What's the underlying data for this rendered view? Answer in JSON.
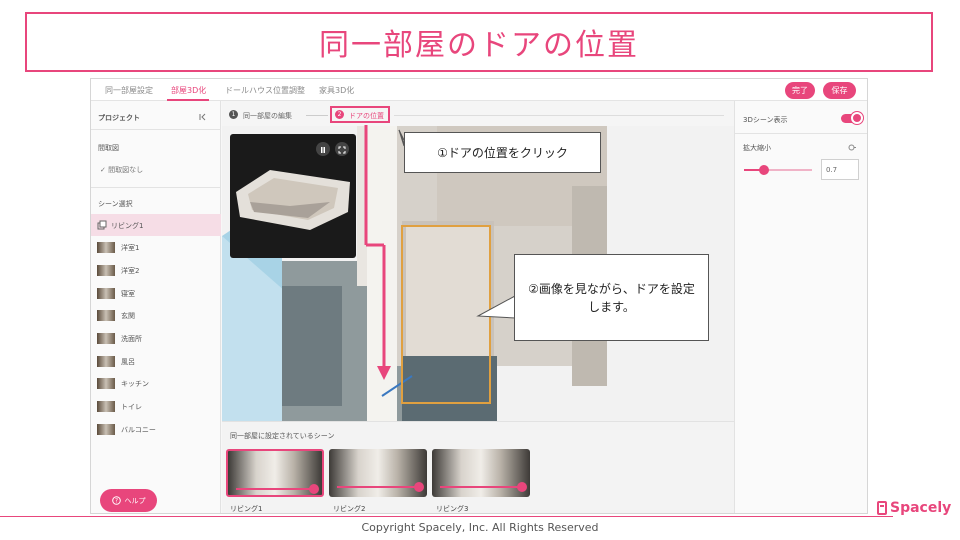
{
  "slide_title": "同一部屋のドアの位置",
  "tabs": [
    {
      "label": "同一部屋設定"
    },
    {
      "label": "部屋3D化"
    },
    {
      "label": "ドールハウス位置調整"
    },
    {
      "label": "家具3D化"
    }
  ],
  "buttons": {
    "complete": "完了",
    "save": "保存",
    "help": "ヘルプ"
  },
  "sidebar": {
    "project_label": "プロジェクト",
    "floorplan_label": "間取図",
    "floorplan_value": "✓ 間取図なし",
    "scene_select_label": "シーン選択",
    "scenes": [
      {
        "label": "リビング1"
      },
      {
        "label": "洋室1"
      },
      {
        "label": "洋室2"
      },
      {
        "label": "寝室"
      },
      {
        "label": "玄関"
      },
      {
        "label": "洗面所"
      },
      {
        "label": "風呂"
      },
      {
        "label": "キッチン"
      },
      {
        "label": "トイレ"
      },
      {
        "label": "バルコニー"
      }
    ]
  },
  "steps": [
    {
      "number": "1",
      "label": "同一部屋の編集"
    },
    {
      "number": "2",
      "label": "ドアの位置"
    }
  ],
  "bottom_panel": {
    "title": "同一部屋に設定されているシーン",
    "scenes": [
      {
        "label": "リビング1"
      },
      {
        "label": "リビング2"
      },
      {
        "label": "リビング3"
      }
    ]
  },
  "right_panel": {
    "scene_display_label": "3Dシーン表示",
    "zoom_label": "拡大縮小",
    "zoom_value": "0.7",
    "zoom_level": 0.3
  },
  "callouts": {
    "first": "①ドアの位置をクリック",
    "second": "②画像を見ながら、ドアを設定します。"
  },
  "footer": {
    "copyright": "Copyright Spacely, Inc. All Rights Reserved",
    "brand": "Spacely"
  },
  "colors": {
    "accent": "#e8467c",
    "door_outline": "#e0a040"
  },
  "icons": [
    "collapse-icon",
    "pause-icon",
    "expand-icon",
    "reset-icon",
    "copy-icon",
    "help-icon",
    "spacely-logo-icon"
  ]
}
